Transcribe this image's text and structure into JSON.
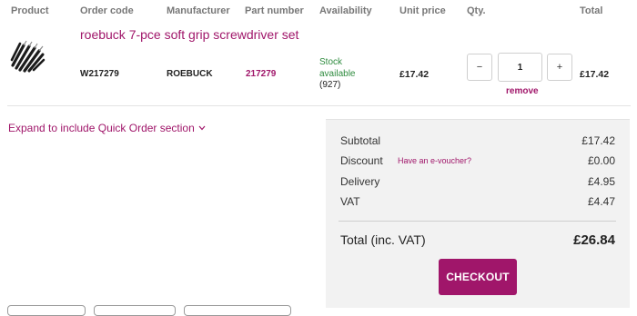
{
  "headers": {
    "product": "Product",
    "order_code": "Order code",
    "manufacturer": "Manufacturer",
    "part_number": "Part number",
    "availability": "Availability",
    "unit_price": "Unit price",
    "qty": "Qty.",
    "total": "Total"
  },
  "item": {
    "name": "roebuck 7-pce soft grip screwdriver set",
    "order_code": "W217279",
    "manufacturer": "ROEBUCK",
    "part_number": "217279",
    "stock_line1": "Stock",
    "stock_line2": "available",
    "stock_count": "(927)",
    "unit_price": "£17.42",
    "quantity": "1",
    "minus": "−",
    "plus": "+",
    "remove": "remove",
    "total": "£17.42",
    "image_icon": "screwdriver-set-image"
  },
  "expand_link": "Expand to include Quick Order section",
  "summary": {
    "subtotal_label": "Subtotal",
    "subtotal_value": "£17.42",
    "discount_label": "Discount",
    "voucher_link": "Have an e-voucher?",
    "discount_value": "£0.00",
    "delivery_label": "Delivery",
    "delivery_value": "£4.95",
    "vat_label": "VAT",
    "vat_value": "£4.47",
    "total_label": "Total (inc. VAT)",
    "total_value": "£26.84",
    "checkout": "CHECKOUT"
  },
  "colors": {
    "accent": "#a0166a",
    "stock_green": "#2e8b3e",
    "panel_bg": "#f2f2f2"
  }
}
